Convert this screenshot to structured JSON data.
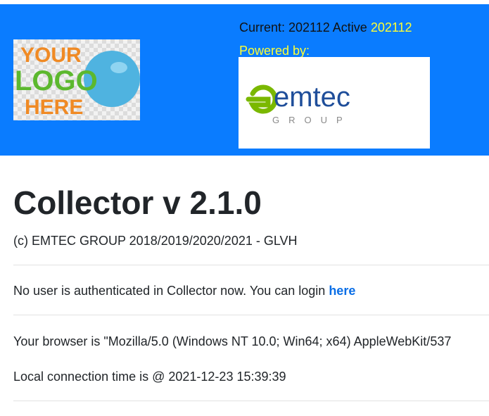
{
  "header": {
    "current_label": "Current: 202112",
    "active_label": "Active",
    "active_value": "202112",
    "powered_by": "Powered by:",
    "your_logo": {
      "line1": "YOUR",
      "line2": "LOGO",
      "line3": "HERE"
    },
    "partner_logo": {
      "brand": "emtec",
      "sub": "GROUP"
    }
  },
  "main": {
    "title": "Collector v 2.1.0",
    "copyright": "(c) EMTEC GROUP 2018/2019/2020/2021 - GLVH",
    "auth_text": "No user is authenticated in Collector now. You can login",
    "login_link": "here",
    "browser_text": "Your browser is \"Mozilla/5.0 (Windows NT 10.0; Win64; x64) AppleWebKit/537",
    "connection_text": "Local connection time is @ 2021-12-23 15:39:39"
  },
  "colors": {
    "header_bg": "#0a7cff",
    "highlight": "#ffff33",
    "link": "#0a6ee6"
  }
}
